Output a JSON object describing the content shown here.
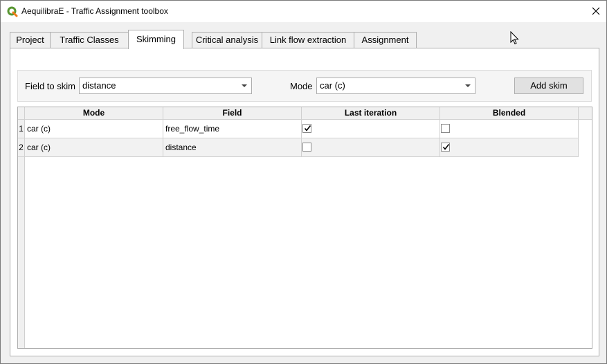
{
  "window": {
    "title": "AequilibraE - Traffic Assignment toolbox",
    "close_symbol": "✕"
  },
  "tabs": [
    {
      "label": "Project"
    },
    {
      "label": "Traffic Classes"
    },
    {
      "label": "Skimming"
    },
    {
      "label": "Critical analysis"
    },
    {
      "label": "Link flow extraction"
    },
    {
      "label": "Assignment"
    }
  ],
  "skimming": {
    "field_label": "Field to skim",
    "field_value": "distance",
    "mode_label": "Mode",
    "mode_value": "car (c)",
    "add_button": "Add skim"
  },
  "table": {
    "headers": [
      "Mode",
      "Field",
      "Last iteration",
      "Blended"
    ],
    "rows": [
      {
        "num": "1",
        "mode": "car (c)",
        "field": "free_flow_time",
        "last_iteration": true,
        "blended": false
      },
      {
        "num": "2",
        "mode": "car (c)",
        "field": "distance",
        "last_iteration": false,
        "blended": true
      }
    ]
  },
  "icons": {
    "app": "qgis-logo-icon",
    "close": "close-icon",
    "check": "checkmark-icon",
    "dropdown": "chevron-down-icon",
    "cursor": "mouse-pointer-icon"
  },
  "colors": {
    "qgis_green": "#589632",
    "qgis_yellow": "#ee7913"
  }
}
